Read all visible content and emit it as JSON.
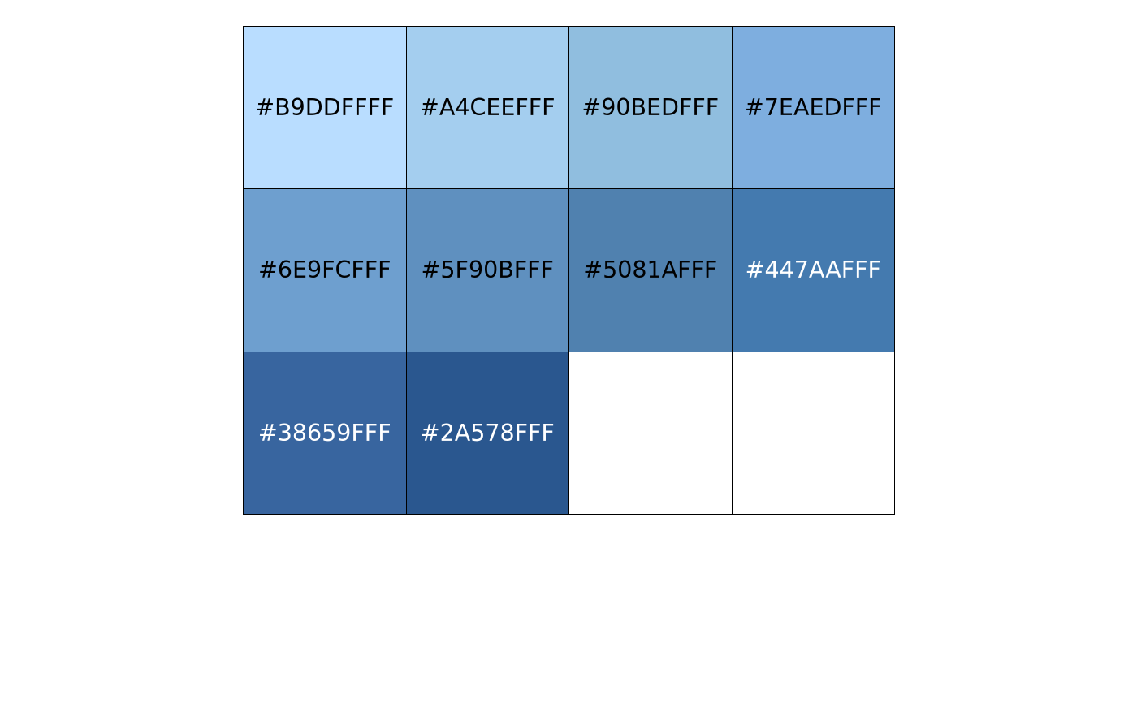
{
  "columns": 4,
  "rows": 3,
  "swatches": [
    {
      "label": "#B9DDFFFF",
      "color": "#B9DDFF",
      "text_color": "#000000"
    },
    {
      "label": "#A4CEEFFF",
      "color": "#A4CEEF",
      "text_color": "#000000"
    },
    {
      "label": "#90BEDFFF",
      "color": "#90BEDF",
      "text_color": "#000000"
    },
    {
      "label": "#7EAEDFFF",
      "color": "#7EAEDF",
      "text_color": "#000000"
    },
    {
      "label": "#6E9FCFFF",
      "color": "#6E9FCF",
      "text_color": "#000000"
    },
    {
      "label": "#5F90BFFF",
      "color": "#5F90BF",
      "text_color": "#000000"
    },
    {
      "label": "#5081AFFF",
      "color": "#5081AF",
      "text_color": "#000000"
    },
    {
      "label": "#447AAFFF",
      "color": "#447AAF",
      "text_color": "#FFFFFF"
    },
    {
      "label": "#38659FFF",
      "color": "#38659F",
      "text_color": "#FFFFFF"
    },
    {
      "label": "#2A578FFF",
      "color": "#2A578F",
      "text_color": "#FFFFFF"
    }
  ]
}
